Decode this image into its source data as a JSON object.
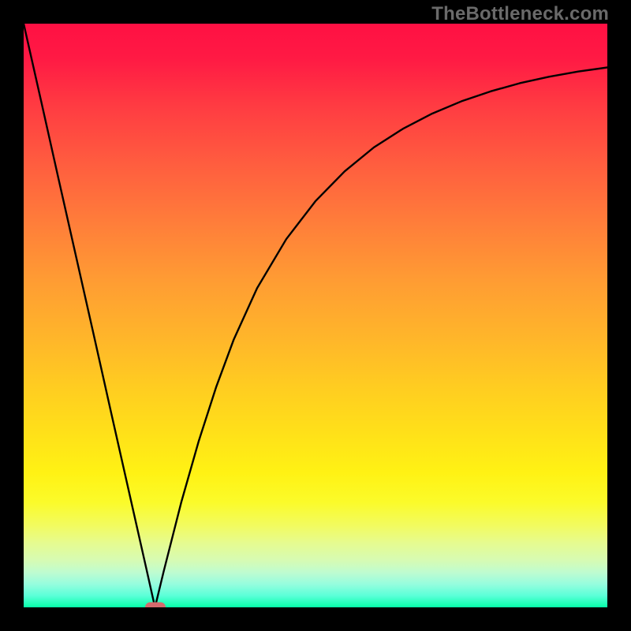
{
  "watermark": {
    "text": "TheBottleneck.com"
  },
  "chart_data": {
    "type": "line",
    "title": "",
    "xlabel": "",
    "ylabel": "",
    "xlim": [
      0,
      100
    ],
    "ylim": [
      0,
      100
    ],
    "grid": false,
    "legend": false,
    "series": [
      {
        "name": "curve",
        "x": [
          0,
          3,
          6,
          9,
          12,
          15,
          18,
          21,
          22.5,
          24,
          27,
          30,
          33,
          36,
          40,
          45,
          50,
          55,
          60,
          65,
          70,
          75,
          80,
          85,
          90,
          95,
          100
        ],
        "y": [
          100,
          86.7,
          73.3,
          60.0,
          46.7,
          33.3,
          20.0,
          6.7,
          0.0,
          6.2,
          18.0,
          28.5,
          37.8,
          45.9,
          54.7,
          63.1,
          69.6,
          74.7,
          78.8,
          82.0,
          84.6,
          86.7,
          88.4,
          89.8,
          90.9,
          91.8,
          92.5
        ]
      }
    ],
    "marker": {
      "x": 22.5,
      "y": 0,
      "color": "#d46a6d"
    },
    "background_gradient": {
      "direction": "vertical",
      "stops": [
        {
          "pos": 0.0,
          "color": "#ff1043"
        },
        {
          "pos": 0.5,
          "color": "#ffb62a"
        },
        {
          "pos": 0.8,
          "color": "#fff214"
        },
        {
          "pos": 1.0,
          "color": "#06ffa9"
        }
      ]
    }
  }
}
